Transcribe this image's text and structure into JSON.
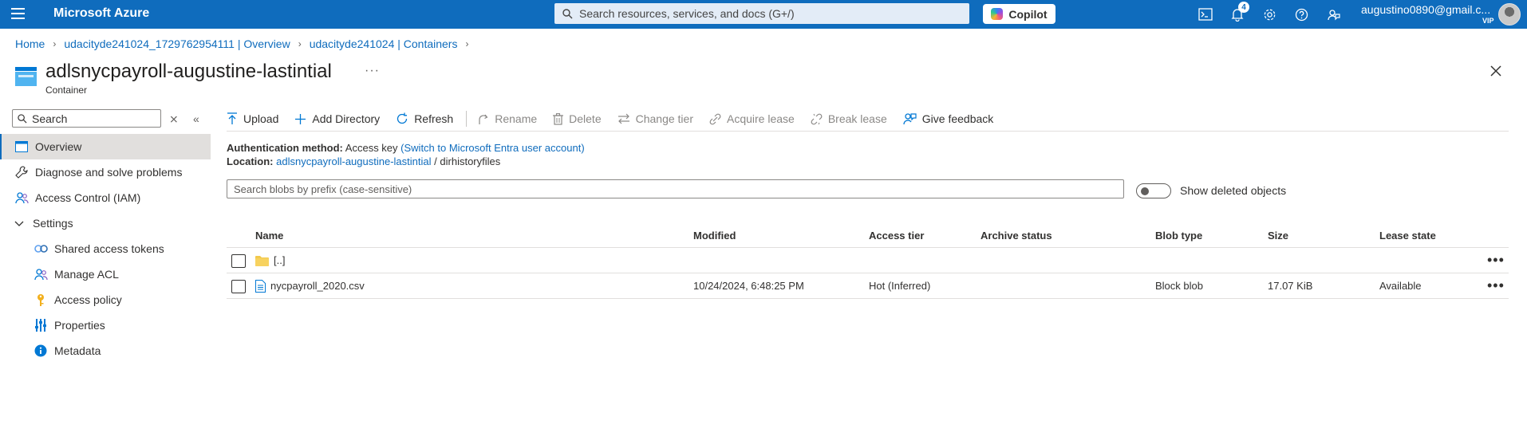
{
  "topbar": {
    "brand": "Microsoft Azure",
    "search_placeholder": "Search resources, services, and docs (G+/)",
    "copilot_label": "Copilot",
    "notifications_count": "4",
    "user_email": "augustino0890@gmail.c...",
    "user_tier": "VIP",
    "accent_color": "#0f6cbd"
  },
  "breadcrumb": {
    "items": [
      "Home",
      "udacityde241024_1729762954111 | Overview",
      "udacityde241024 | Containers"
    ]
  },
  "page": {
    "title": "adlsnycpayroll-augustine-lastintial",
    "subtitle": "Container",
    "more_label": "···"
  },
  "nav": {
    "search_placeholder": "Search",
    "items": [
      {
        "label": "Overview",
        "icon": "overview-icon",
        "active": true
      },
      {
        "label": "Diagnose and solve problems",
        "icon": "wrench-icon"
      },
      {
        "label": "Access Control (IAM)",
        "icon": "people-icon"
      },
      {
        "label": "Settings",
        "icon": "chevron-down-icon"
      },
      {
        "label": "Shared access tokens",
        "icon": "link-icon"
      },
      {
        "label": "Manage ACL",
        "icon": "people-icon"
      },
      {
        "label": "Access policy",
        "icon": "key-icon"
      },
      {
        "label": "Properties",
        "icon": "properties-icon"
      },
      {
        "label": "Metadata",
        "icon": "info-icon"
      }
    ]
  },
  "toolbar": {
    "upload": "Upload",
    "add_directory": "Add Directory",
    "refresh": "Refresh",
    "rename": "Rename",
    "delete": "Delete",
    "change_tier": "Change tier",
    "acquire_lease": "Acquire lease",
    "break_lease": "Break lease",
    "give_feedback": "Give feedback"
  },
  "auth": {
    "label": "Authentication method:",
    "value": "Access key",
    "switch_link": "(Switch to Microsoft Entra user account)"
  },
  "location": {
    "label": "Location:",
    "container_link": "adlsnycpayroll-augustine-lastintial",
    "separator": "/",
    "folder": "dirhistoryfiles"
  },
  "blob_search": {
    "placeholder": "Search blobs by prefix (case-sensitive)"
  },
  "toggle": {
    "label": "Show deleted objects",
    "on": false
  },
  "table": {
    "columns": [
      "Name",
      "Modified",
      "Access tier",
      "Archive status",
      "Blob type",
      "Size",
      "Lease state"
    ],
    "rows": [
      {
        "name": "[..]",
        "icon": "folder-icon",
        "modified": "",
        "access_tier": "",
        "archive_status": "",
        "blob_type": "",
        "size": "",
        "lease_state": ""
      },
      {
        "name": "nycpayroll_2020.csv",
        "icon": "file-icon",
        "modified": "10/24/2024, 6:48:25 PM",
        "access_tier": "Hot (Inferred)",
        "archive_status": "",
        "blob_type": "Block blob",
        "size": "17.07 KiB",
        "lease_state": "Available"
      }
    ]
  }
}
